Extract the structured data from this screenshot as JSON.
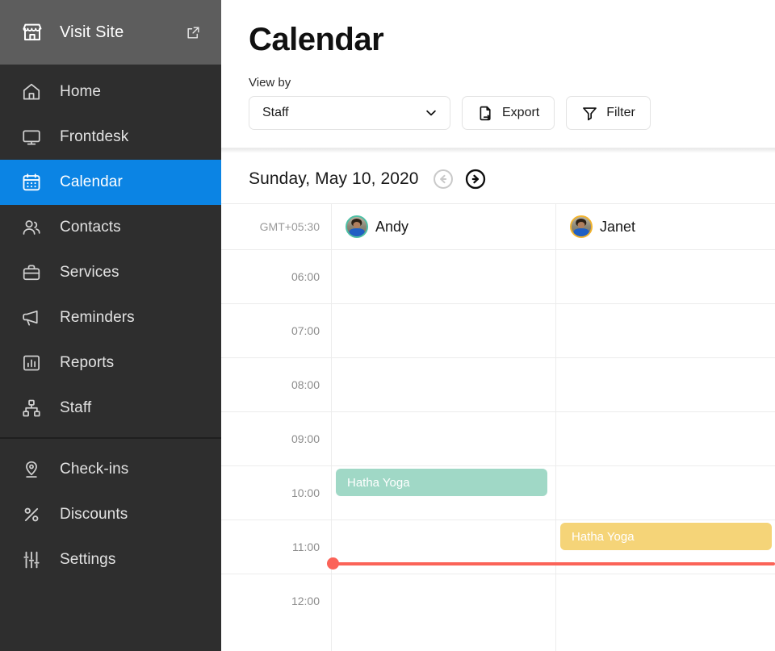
{
  "sidebar": {
    "visit_site": {
      "label": "Visit Site",
      "icon": "storefront-icon",
      "external_icon": "external-link-icon"
    },
    "primary_items": [
      {
        "label": "Home",
        "icon": "home-icon",
        "active": false
      },
      {
        "label": "Frontdesk",
        "icon": "monitor-icon",
        "active": false
      },
      {
        "label": "Calendar",
        "icon": "calendar-icon",
        "active": true
      },
      {
        "label": "Contacts",
        "icon": "people-icon",
        "active": false
      },
      {
        "label": "Services",
        "icon": "briefcase-icon",
        "active": false
      },
      {
        "label": "Reminders",
        "icon": "megaphone-icon",
        "active": false
      },
      {
        "label": "Reports",
        "icon": "bar-chart-icon",
        "active": false
      },
      {
        "label": "Staff",
        "icon": "org-chart-icon",
        "active": false
      }
    ],
    "secondary_items": [
      {
        "label": "Check-ins",
        "icon": "location-pin-icon",
        "active": false
      },
      {
        "label": "Discounts",
        "icon": "percent-icon",
        "active": false
      },
      {
        "label": "Settings",
        "icon": "sliders-icon",
        "active": false
      }
    ],
    "active_color": "#0b84e4",
    "background": "#2e2e2e",
    "visit_site_background": "#5d5d5d"
  },
  "header": {
    "title": "Calendar",
    "view_by_label": "View by",
    "view_by_value": "Staff",
    "view_by_options": [
      "Staff"
    ],
    "export_label": "Export",
    "export_icon": "file-export-icon",
    "filter_label": "Filter",
    "filter_icon": "funnel-icon",
    "dropdown_icon": "chevron-down-icon"
  },
  "date_bar": {
    "date": "Sunday, May 10, 2020",
    "prev_icon": "arrow-left-circle-icon",
    "next_icon": "arrow-right-circle-icon",
    "prev_disabled": true,
    "next_disabled": false
  },
  "calendar": {
    "timezone": "GMT+05:30",
    "columns": [
      {
        "name": "Andy",
        "ring_color": "#4cc0a5"
      },
      {
        "name": "Janet",
        "ring_color": "#f2b32c"
      }
    ],
    "time_slots": [
      "06:00",
      "07:00",
      "08:00",
      "09:00",
      "10:00",
      "11:00",
      "12:00"
    ],
    "events": [
      {
        "title": "Hatha Yoga",
        "column": "Andy",
        "start": "10:00",
        "color": "#a0d8c6"
      },
      {
        "title": "Hatha Yoga",
        "column": "Janet",
        "start": "11:00",
        "color": "#f5d478"
      }
    ],
    "current_time_indicator": {
      "color": "#fb6358",
      "position_between": [
        "11:00",
        "12:00"
      ]
    }
  }
}
